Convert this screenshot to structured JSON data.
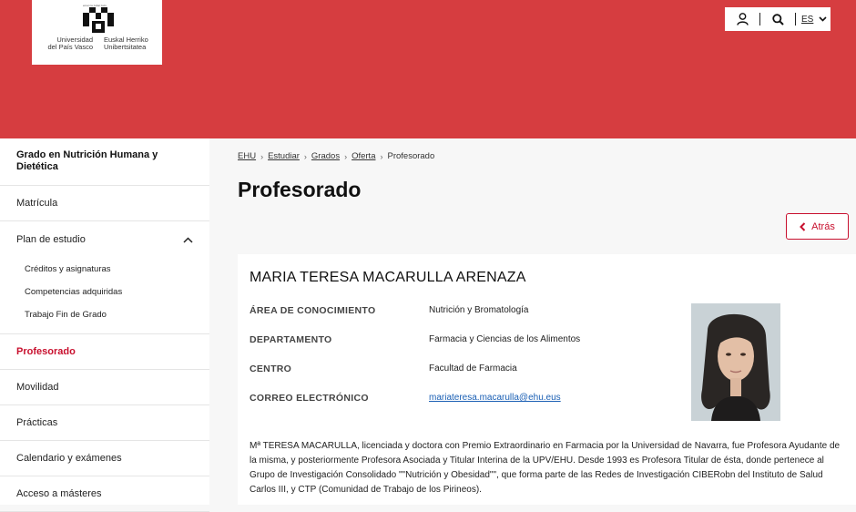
{
  "header": {
    "logo": {
      "tagline": "eman ta zabal zazu",
      "name_es": "Universidad del País Vasco",
      "name_es_line1": "Universidad",
      "name_es_line2": "del País Vasco",
      "name_eu_line1": "Euskal Herriko",
      "name_eu_line2": "Unibertsitatea"
    },
    "utility": {
      "user_icon": "user-icon",
      "search_icon": "search-icon",
      "language": "ES"
    },
    "color": "#d63d40"
  },
  "sidebar": {
    "title": "Grado en Nutrición Humana y Dietética",
    "items": [
      {
        "label": "Matrícula"
      },
      {
        "label": "Plan de estudio",
        "expanded": true,
        "children": [
          {
            "label": "Créditos y asignaturas"
          },
          {
            "label": "Competencias adquiridas"
          },
          {
            "label": "Trabajo Fin de Grado"
          }
        ]
      },
      {
        "label": "Profesorado",
        "active": true
      },
      {
        "label": "Movilidad"
      },
      {
        "label": "Prácticas"
      },
      {
        "label": "Calendario y exámenes"
      },
      {
        "label": "Acceso a másteres"
      }
    ]
  },
  "breadcrumb": [
    "EHU",
    "Estudiar",
    "Grados",
    "Oferta",
    "Profesorado"
  ],
  "page": {
    "title": "Profesorado",
    "back_label": "Atrás"
  },
  "profile": {
    "name": "MARIA TERESA MACARULLA ARENAZA",
    "fields": [
      {
        "label": "ÁREA DE CONOCIMIENTO",
        "value": "Nutrición y Bromatología"
      },
      {
        "label": "DEPARTAMENTO",
        "value": "Farmacia y Ciencias de los Alimentos"
      },
      {
        "label": "CENTRO",
        "value": "Facultad de Farmacia"
      },
      {
        "label": "CORREO ELECTRÓNICO",
        "value": "mariateresa.macarulla@ehu.eus"
      }
    ],
    "bio": "Mª TERESA MACARULLA, licenciada y doctora con Premio Extraordinario en Farmacia por la Universidad de Navarra, fue Profesora Ayudante de la misma, y posteriormente Profesora Asociada y Titular Interina de la UPV/EHU. Desde 1993 es Profesora Titular de ésta, donde pertenece al Grupo de Investigación Consolidado \"\"Nutrición y Obesidad\"\", que forma parte de las Redes de Investigación CIBERobn del Instituto de Salud Carlos III, y CTP (Comunidad de Trabajo de los Pirineos)."
  },
  "colors": {
    "accent": "#c8102e",
    "link": "#1a5fb4"
  }
}
